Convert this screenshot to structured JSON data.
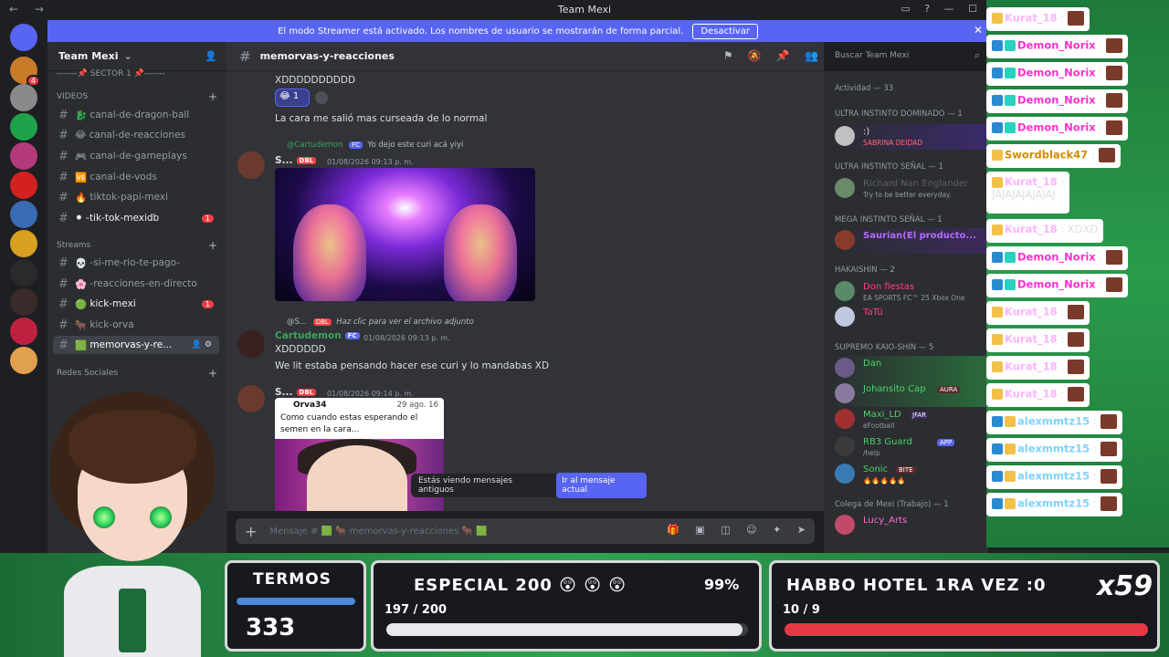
{
  "titlebar": {
    "title": "Team Mexi",
    "back": "←",
    "forward": "→",
    "controls": [
      "▭",
      "?",
      "—",
      "☐"
    ]
  },
  "banner": {
    "text": "El modo Streamer está activado. Los nombres de usuario se mostrarán de forma parcial.",
    "button": "Desactivar",
    "close": "✕"
  },
  "server": {
    "name": "Team Mexi"
  },
  "sidebar": {
    "categories": [
      {
        "label": "-------📌 SECTOR 1 📌-------"
      },
      {
        "label": "VIDEOS"
      },
      {
        "label": "Streams"
      },
      {
        "label": "Redes Sociales"
      }
    ],
    "channels": [
      {
        "label": "canal-de-dragon-ball",
        "emoji": "🐉",
        "badge": ""
      },
      {
        "label": "canal-de-reacciones",
        "emoji": "😂",
        "badge": ""
      },
      {
        "label": "canal-de-gameplays",
        "emoji": "🎮",
        "badge": ""
      },
      {
        "label": "canal-de-vods",
        "emoji": "🆚",
        "badge": ""
      },
      {
        "label": "tiktok-papi-mexi",
        "emoji": "🔥",
        "badge": ""
      },
      {
        "label": "-tik-tok-mexidb",
        "emoji": "⚫",
        "badge": "1"
      },
      {
        "label": "-si-me-rio-te-pago-",
        "emoji": "💀",
        "badge": ""
      },
      {
        "label": "-reacciones-en-directo",
        "emoji": "🌸",
        "badge": ""
      },
      {
        "label": "kick-mexi",
        "emoji": "🟢",
        "badge": "1"
      },
      {
        "label": "kick-orva",
        "emoji": "🐂",
        "badge": ""
      },
      {
        "label": "memorvas-y-re...",
        "emoji": "🟩",
        "badge": ""
      }
    ]
  },
  "chat": {
    "channel": "memorvas-y-reacciones",
    "messages": [
      {
        "text": "XDDDDDDDDDD"
      },
      {
        "reaction_emoji": "😂",
        "reaction_count": "1"
      },
      {
        "text": "La cara me salió mas curseada de lo normal"
      },
      {
        "reply_user": "@Cartudemon",
        "reply_tag": "FC",
        "reply_text": "Yo dejo este curi acá yiyi",
        "user": "S...",
        "badge": "DBL",
        "time": "01/08/2026 09:13 p. m."
      },
      {
        "reply_user": "@S...",
        "reply_tag": "DBL",
        "reply_text": "Haz clic para ver el archivo adjunto",
        "user": "Cartudemon",
        "badge": "FC",
        "time": "01/08/2026 09:13 p. m.",
        "text": "XDDDDDD",
        "text2": "We lit estaba pensando hacer ese curi y lo mandabas XD"
      },
      {
        "user": "S...",
        "badge": "DBL",
        "time": "01/08/2026 09:14 p. m."
      }
    ],
    "tweet": {
      "name": "Orva34",
      "date": "29 ago. 16",
      "body": "Como cuando estas esperando el semen en la cara..."
    },
    "old_messages": {
      "text": "Estás viendo mensajes antiguos",
      "button": "Ir al mensaje actual"
    },
    "composer_placeholder": "Mensaje # 🟩 🐂 memorvas-y-reacciones 🐂 🟩"
  },
  "search": {
    "placeholder": "Buscar Team Mexi"
  },
  "members": {
    "activity": "Actividad — 33",
    "groups": [
      {
        "title": "ULTRA INSTINTO DOMINADO — 1"
      },
      {
        "title": "ULTRA INSTINTO SEÑAL — 1"
      },
      {
        "title": "MEGA INSTINTO SEÑAL — 1"
      },
      {
        "title": "HAKAISHIN — 2"
      },
      {
        "title": "SUPREMO KAIO-SHIN — 5"
      },
      {
        "title": "Colega de Mexi (Trabajo) — 1"
      }
    ],
    "list": [
      {
        "name": ":)",
        "sub": "SABRINA DEIDAD",
        "color": "#ffffff"
      },
      {
        "name": "Richard Nan Englander",
        "sub": "Try to be better everyday.",
        "color": "#5c5f66"
      },
      {
        "name": "Saurian(El producto...",
        "sub": "",
        "color": "#b46bff"
      },
      {
        "name": "Don fiestas",
        "sub": "EA SPORTS FC™ 25 Xbox One",
        "color": "#ff3d8a"
      },
      {
        "name": "TaTü",
        "sub": "",
        "color": "#ff3d8a"
      },
      {
        "name": "Dan",
        "sub": "",
        "color": "#4ad36b"
      },
      {
        "name": "Johansito Cap",
        "sub": "",
        "tag": "AURA",
        "color": "#4ad36b"
      },
      {
        "name": "Maxi_LD",
        "sub": "eFootball",
        "tag": "JFAR",
        "color": "#4ad36b"
      },
      {
        "name": "RB3 Guard",
        "sub": "/help",
        "tag": "APP",
        "color": "#4ad36b"
      },
      {
        "name": "Sonic",
        "sub": "🔥🔥🔥🔥🔥",
        "tag": "BITE",
        "color": "#4ad36b"
      },
      {
        "name": "Lucy_Arts",
        "sub": "",
        "color": "#ff6bd1"
      }
    ]
  },
  "stream_chat": [
    {
      "user": "Kurat_18",
      "text": " :",
      "color": "#ffb3ff"
    },
    {
      "user": "Demon_Norix",
      "text": " :",
      "color": "#ff2fd0"
    },
    {
      "user": "Demon_Norix",
      "text": " :",
      "color": "#ff2fd0"
    },
    {
      "user": "Demon_Norix",
      "text": " :",
      "color": "#ff2fd0"
    },
    {
      "user": "Demon_Norix",
      "text": " :",
      "color": "#ff2fd0"
    },
    {
      "user": "Swordblack47",
      "text": " :",
      "color": "#d48a00"
    },
    {
      "user": "Kurat_18",
      "text": " :",
      "color": "#ffb3ff",
      "line2": "JAJAJAJAJAJAJ"
    },
    {
      "user": "Kurat_18",
      "text": " : XDXD",
      "color": "#ffb3ff"
    },
    {
      "user": "Demon_Norix",
      "text": " :",
      "color": "#ff2fd0"
    },
    {
      "user": "Demon_Norix",
      "text": " :",
      "color": "#ff2fd0"
    },
    {
      "user": "Kurat_18",
      "text": " :",
      "color": "#ffb3ff"
    },
    {
      "user": "Kurat_18",
      "text": " :",
      "color": "#ffb3ff"
    },
    {
      "user": "Kurat_18",
      "text": " :",
      "color": "#ffb3ff"
    },
    {
      "user": "Kurat_18",
      "text": " :",
      "color": "#ffb3ff"
    },
    {
      "user": "alexmmtz15",
      "text": " :",
      "color": "#7fd3ff"
    },
    {
      "user": "alexmmtz15",
      "text": " :",
      "color": "#7fd3ff"
    },
    {
      "user": "alexmmtz15",
      "text": " :",
      "color": "#7fd3ff"
    },
    {
      "user": "alexmmtz15",
      "text": " :",
      "color": "#7fd3ff"
    }
  ],
  "overlay": {
    "termos": {
      "title": "TERMOS",
      "value": "333"
    },
    "especial": {
      "title": "ESPECIAL 200 😲 😲 😲",
      "percent": "99%",
      "count": "197 / 200",
      "progress": 0.985
    },
    "habbo": {
      "title": "HABBO HOTEL 1RA VEZ :0",
      "count": "10 / 9",
      "multiplier": "x59",
      "progress": 1.0
    }
  }
}
